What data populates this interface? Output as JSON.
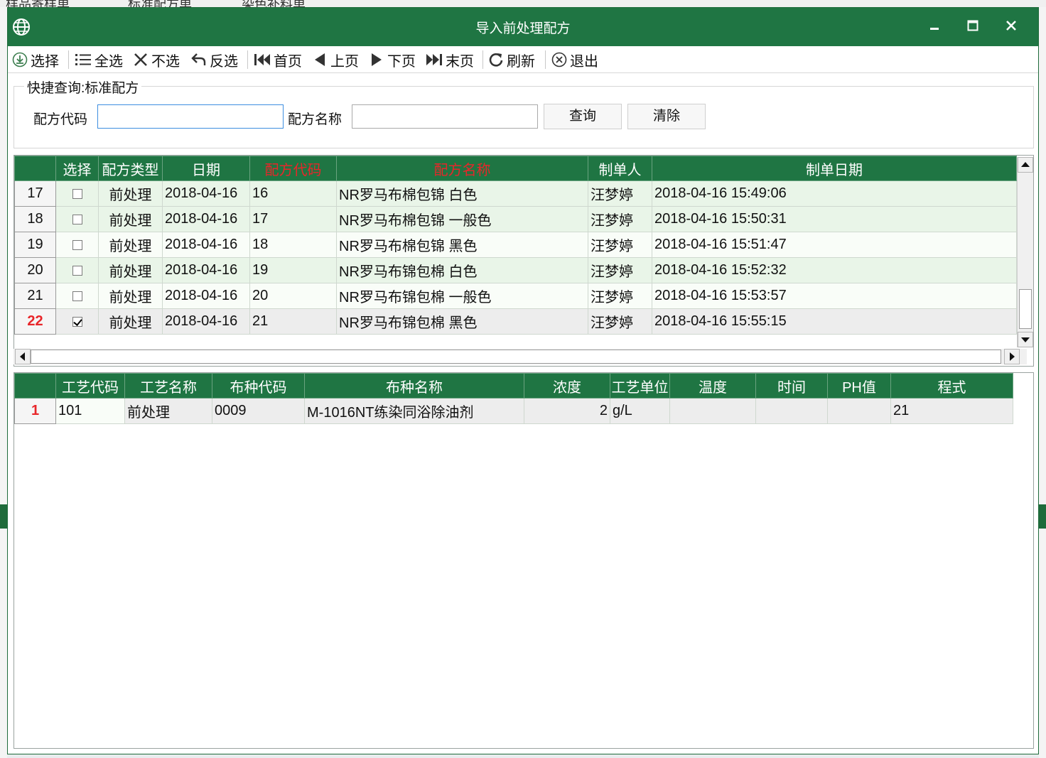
{
  "window": {
    "title": "导入前处理配方",
    "controls": {
      "minimize": "▬",
      "maximize": "■",
      "close": "✕"
    }
  },
  "background": {
    "tabs": [
      "样品寄样单",
      "标准配方单",
      "染色补料单"
    ]
  },
  "toolbar": {
    "items": [
      {
        "label": "选择",
        "icon": "download-icon"
      },
      {
        "label": "全选",
        "icon": "list-icon"
      },
      {
        "label": "不选",
        "icon": "x-icon"
      },
      {
        "label": "反选",
        "icon": "undo-arrow-icon"
      },
      {
        "label": "首页",
        "icon": "first-page-icon"
      },
      {
        "label": "上页",
        "icon": "prev-page-icon"
      },
      {
        "label": "下页",
        "icon": "next-page-icon"
      },
      {
        "label": "末页",
        "icon": "last-page-icon"
      },
      {
        "label": "刷新",
        "icon": "refresh-icon"
      },
      {
        "label": "退出",
        "icon": "exit-icon"
      }
    ]
  },
  "quick_search": {
    "title": "快捷查询:标准配方",
    "code_label": "配方代码",
    "code_value": "",
    "name_label": "配方名称",
    "name_value": "",
    "query_button": "查询",
    "clear_button": "清除"
  },
  "recipe_grid": {
    "columns": [
      "选择",
      "配方类型",
      "日期",
      "配方代码",
      "配方名称",
      "制单人",
      "制单日期"
    ],
    "highlight_color": "#e8262a",
    "header_color": "#1f7543",
    "rows": [
      {
        "rownum": "17",
        "checked": false,
        "type": "前处理",
        "date": "2018-04-16",
        "code": "16",
        "name": "NR罗马布棉包锦 白色",
        "maker": "汪梦婷",
        "made_at": "2018-04-16 15:49:06"
      },
      {
        "rownum": "18",
        "checked": false,
        "type": "前处理",
        "date": "2018-04-16",
        "code": "17",
        "name": "NR罗马布棉包锦 一般色",
        "maker": "汪梦婷",
        "made_at": "2018-04-16 15:50:31"
      },
      {
        "rownum": "19",
        "checked": false,
        "type": "前处理",
        "date": "2018-04-16",
        "code": "18",
        "name": "NR罗马布棉包锦 黑色",
        "maker": "汪梦婷",
        "made_at": "2018-04-16 15:51:47"
      },
      {
        "rownum": "20",
        "checked": false,
        "type": "前处理",
        "date": "2018-04-16",
        "code": "19",
        "name": "NR罗马布锦包棉 白色",
        "maker": "汪梦婷",
        "made_at": "2018-04-16 15:52:32"
      },
      {
        "rownum": "21",
        "checked": false,
        "type": "前处理",
        "date": "2018-04-16",
        "code": "20",
        "name": "NR罗马布锦包棉 一般色",
        "maker": "汪梦婷",
        "made_at": "2018-04-16 15:53:57"
      },
      {
        "rownum": "22",
        "checked": true,
        "type": "前处理",
        "date": "2018-04-16",
        "code": "21",
        "name": "NR罗马布锦包棉 黑色",
        "maker": "汪梦婷",
        "made_at": "2018-04-16 15:55:15"
      }
    ]
  },
  "detail_grid": {
    "columns": [
      "工艺代码",
      "工艺名称",
      "布种代码",
      "布种名称",
      "浓度",
      "工艺单位",
      "温度",
      "时间",
      "PH值",
      "程式"
    ],
    "rows": [
      {
        "rownum": "1",
        "proc_code": "101",
        "proc_name": "前处理",
        "fabric_code": "0009",
        "fabric_name": "M-1016NT练染同浴除油剂",
        "concentration": "2",
        "unit": "g/L",
        "temp": "",
        "time": "",
        "ph": "",
        "program": "21"
      }
    ]
  }
}
